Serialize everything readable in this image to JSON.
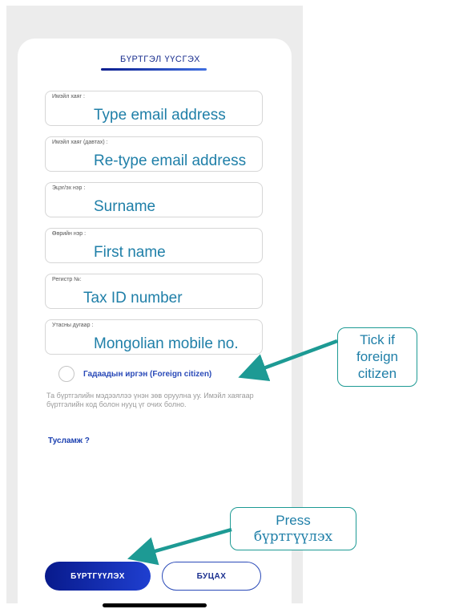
{
  "form": {
    "title": "БҮРТГЭЛ ҮҮСГЭХ",
    "fields": [
      {
        "label": "Имэйл хаяг :",
        "value": "Type email address"
      },
      {
        "label": "Имэйл хаяг (давтах) :",
        "value": "Re-type email address"
      },
      {
        "label": "Эцэг/эх нэр :",
        "value": "Surname"
      },
      {
        "label": "Өөрийн нэр :",
        "value": "First name"
      },
      {
        "label": "Регистр №:",
        "value": "Tax ID number"
      },
      {
        "label": "Утасны дугаар :",
        "value": "Mongolian mobile no."
      }
    ],
    "foreign_citizen_label": "Гадаадын иргэн (Foreign citizen)",
    "info_text": "Та бүртгэлийн мэдээллээ үнэн зөв оруулна уу. Имэйл хаягаар бүртгэлийн код болон нууц үг очих болно.",
    "help_link": "Тусламж ?",
    "register_button": "БҮРТГҮҮЛЭХ",
    "back_button": "БУЦАХ"
  },
  "annotations": {
    "foreign_callout": [
      "Tick if",
      "foreign",
      "citizen"
    ],
    "press_callout": [
      "Press",
      "бүртгүүлэх"
    ]
  },
  "colors": {
    "accent": "#1a2f8f",
    "annotation": "#1d9a94",
    "annotation_text": "#1f7fa8"
  }
}
